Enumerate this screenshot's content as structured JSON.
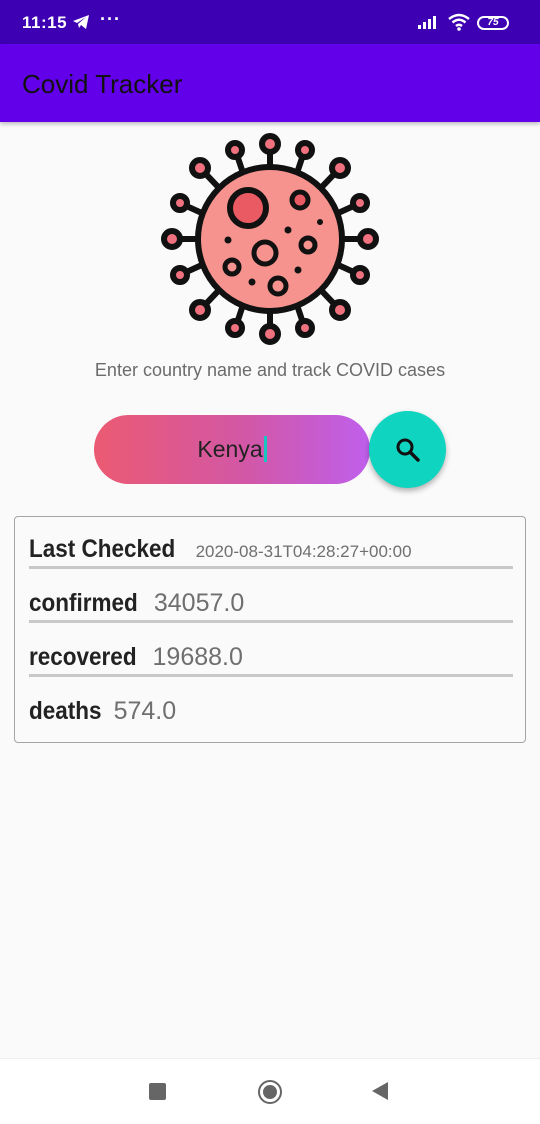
{
  "status_bar": {
    "time": "11:15",
    "dots": "···",
    "battery": "75"
  },
  "app_bar": {
    "title": "Covid Tracker",
    "color": "#6200ea"
  },
  "main": {
    "subtitle": "Enter country name and track COVID cases",
    "search": {
      "value": "Kenya",
      "gradient": [
        "#eb5a72",
        "#bf5fec"
      ]
    },
    "search_button": {
      "icon": "search-icon",
      "color": "#0fd4c0"
    }
  },
  "results": {
    "last_checked_label": "Last Checked",
    "last_checked_value": "2020-08-31T04:28:27+00:00",
    "confirmed_label": "confirmed",
    "confirmed_value": "34057.0",
    "recovered_label": "recovered",
    "recovered_value": "19688.0",
    "deaths_label": "deaths",
    "deaths_value": "574.0"
  },
  "nav_bar": {
    "icons": [
      "recent-apps-icon",
      "home-icon",
      "back-icon"
    ]
  }
}
